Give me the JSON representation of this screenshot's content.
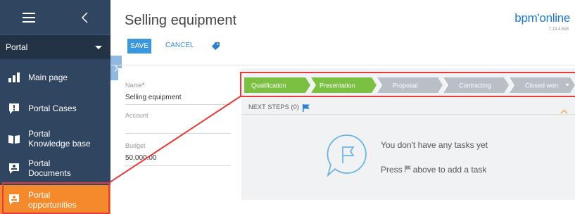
{
  "sidebar": {
    "section": "Portal",
    "items": [
      {
        "label": "Main page"
      },
      {
        "label": "Portal Cases"
      },
      {
        "label": "Portal\nKnowledge base"
      },
      {
        "label": "Portal\nDocuments"
      },
      {
        "label": "Portal\nopportunities"
      }
    ]
  },
  "header": {
    "title": "Selling equipment",
    "logo": "bpm'online",
    "version": "7.13.4.528",
    "save_label": "SAVE",
    "cancel_label": "CANCEL"
  },
  "form": {
    "name_label": "Name",
    "name_required_mark": "*",
    "name_value": "Selling equipment",
    "account_label": "Account",
    "account_value": "",
    "budget_label": "Budget",
    "budget_value": "50,000.00"
  },
  "stages": [
    "Qualification",
    "Presentation",
    "Proposal",
    "Contracting",
    "Closed won"
  ],
  "stage_current_index": 1,
  "tasks": {
    "next_steps_label": "NEXT STEPS (0)",
    "empty_title": "You don't have any tasks yet",
    "empty_hint_before": "Press",
    "empty_hint_after": "above to add a task"
  },
  "colors": {
    "sidebar_bg": "#2f4560",
    "active_item": "#f58a2c",
    "stage_done": "#7bc043",
    "stage_todo": "#b8bfc6",
    "accent": "#3a96dd",
    "callout": "#e53b3b"
  }
}
